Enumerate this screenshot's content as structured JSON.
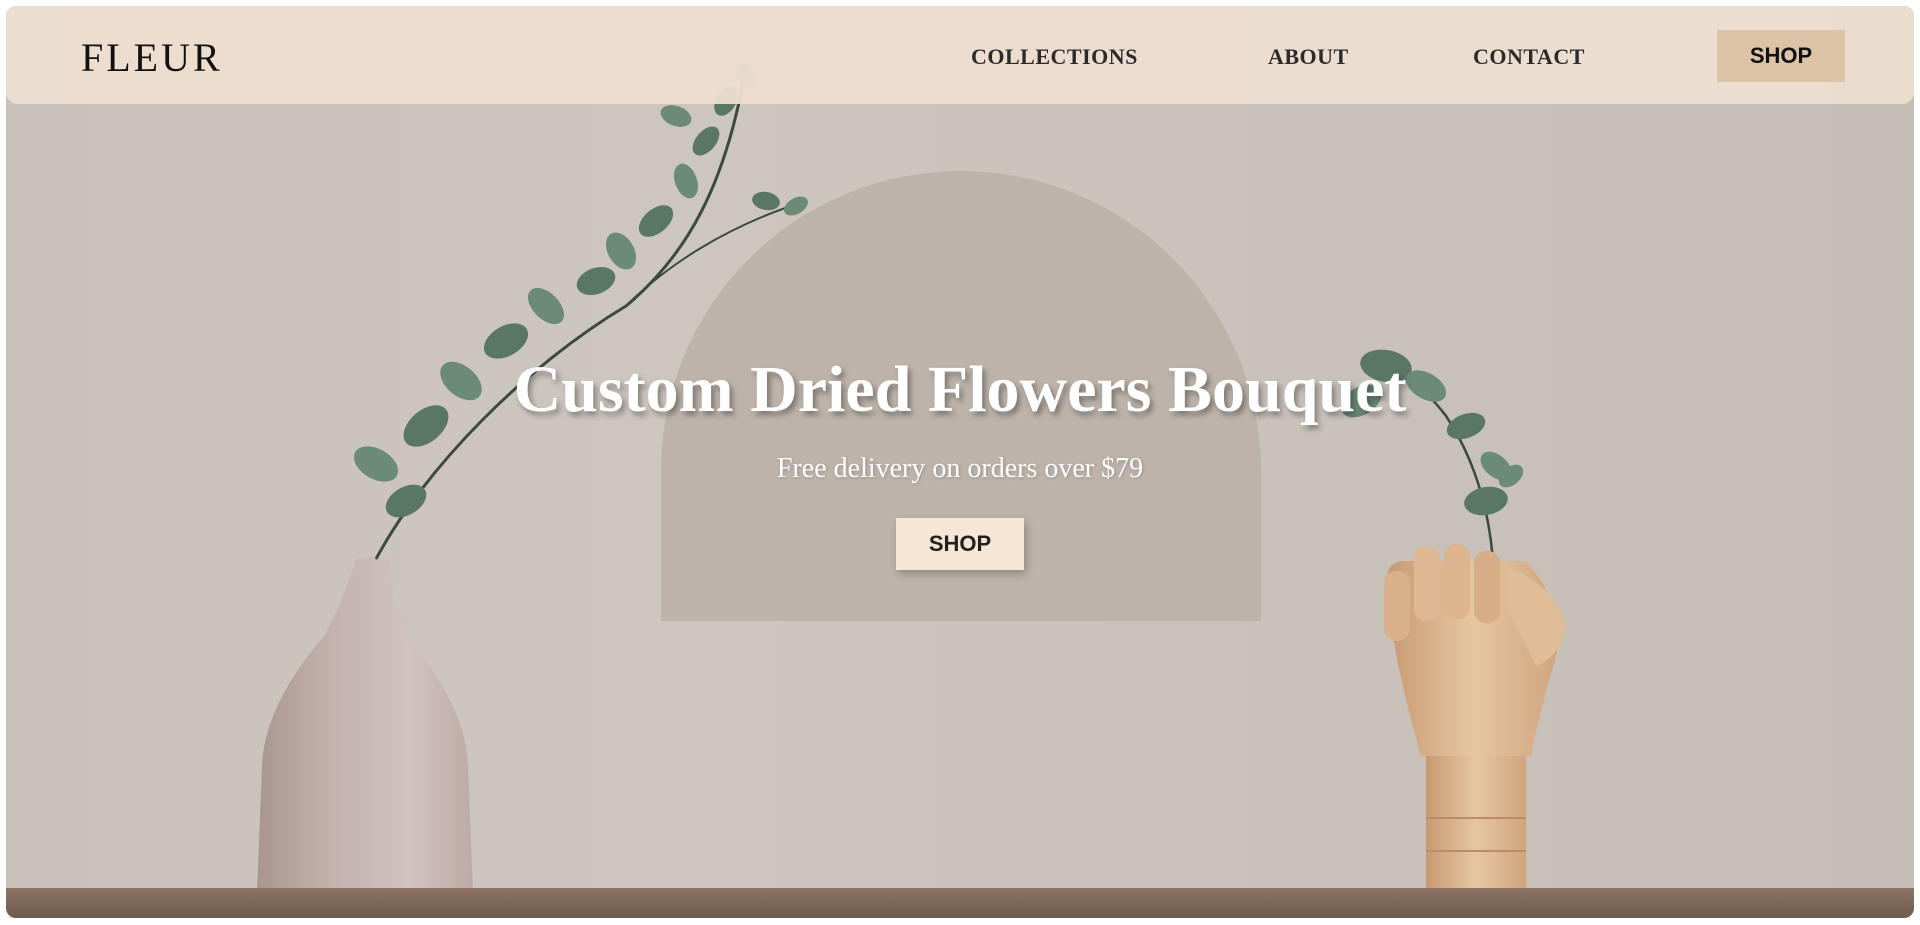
{
  "nav": {
    "logo": "FLEUR",
    "links": [
      "COLLECTIONS",
      "ABOUT",
      "CONTACT"
    ],
    "shop_label": "SHOP"
  },
  "hero": {
    "title": "Custom Dried Flowers Bouquet",
    "subtitle": "Free delivery on orders over $79",
    "shop_label": "SHOP",
    "image_subject": "eucalyptus stem arching from a ceramic vase to a wooden mannequin hand"
  },
  "colors": {
    "nav_bg": "#ecdccf",
    "nav_shop_bg": "#dcc3a8",
    "hero_shop_bg": "#f5e6d6",
    "arch": "#bdb3aa",
    "wall": "#cac3bc",
    "vase": "#b9a7a2",
    "leaf": "#5a7766"
  }
}
